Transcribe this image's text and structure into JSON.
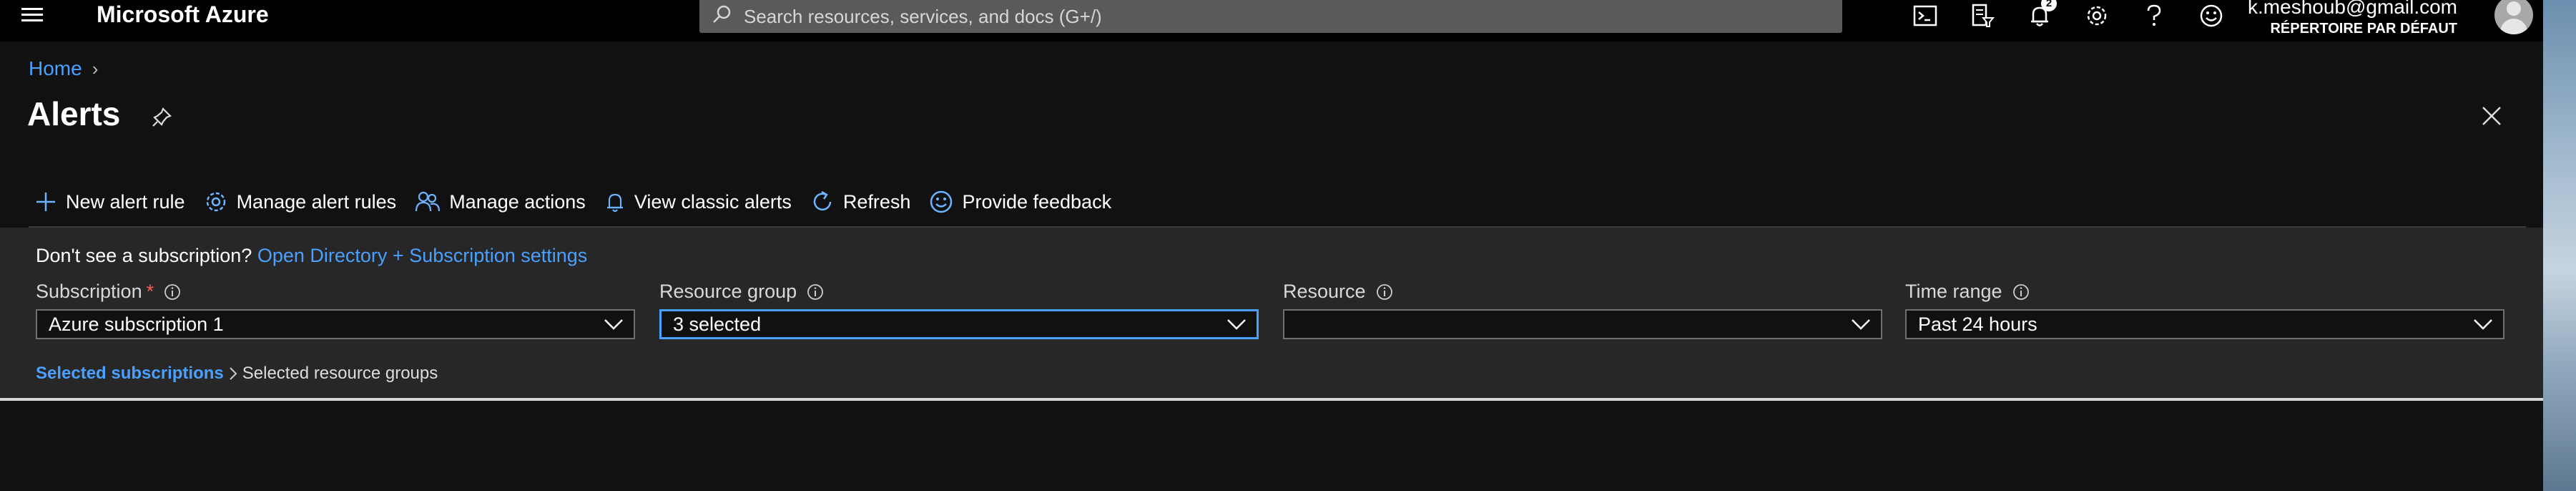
{
  "topbar": {
    "brand": "Microsoft Azure",
    "search_placeholder": "Search resources, services, and docs (G+/)",
    "notification_count": "2",
    "account_email": "k.meshoub@gmail.com",
    "account_directory": "RÉPERTOIRE PAR DÉFAUT",
    "icons": [
      "hamburger-icon",
      "cloud-shell-icon",
      "directory-filter-icon",
      "bell-icon",
      "gear-icon",
      "help-icon",
      "feedback-smiley-icon",
      "avatar"
    ]
  },
  "breadcrumb": {
    "home": "Home"
  },
  "page": {
    "title": "Alerts"
  },
  "toolbar": {
    "new_alert_rule": "New alert rule",
    "manage_alert_rules": "Manage alert rules",
    "manage_actions": "Manage actions",
    "view_classic_alerts": "View classic alerts",
    "refresh": "Refresh",
    "provide_feedback": "Provide feedback"
  },
  "notice": {
    "text": "Don't see a subscription?",
    "link": "Open Directory + Subscription settings"
  },
  "filters": {
    "subscription": {
      "label": "Subscription",
      "required": "*",
      "value": "Azure subscription 1"
    },
    "resource_group": {
      "label": "Resource group",
      "value": "3 selected"
    },
    "resource": {
      "label": "Resource",
      "value": ""
    },
    "time_range": {
      "label": "Time range",
      "value": "Past 24 hours"
    }
  },
  "filter_crumbs": {
    "active": "Selected subscriptions",
    "next": "Selected resource groups"
  },
  "colors": {
    "accent": "#4aa0ff",
    "required": "#ff5a5a",
    "panel": "#272727",
    "background": "#111111"
  }
}
